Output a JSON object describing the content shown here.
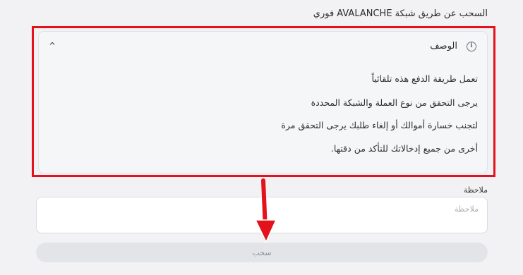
{
  "page": {
    "title": "السحب عن طريق شبكة AVALANCHE فوري"
  },
  "description": {
    "title": "الوصف",
    "info_icon": "i",
    "chevron_icon": "^",
    "lines": [
      "تعمل طريقة الدفع هذه تلقائياً",
      "يرجى التحقق من نوع العملة والشبكة المحددة",
      "لتجنب خسارة أموالك أو إلغاء طلبك يرجى التحقق مرة",
      "أخرى من جميع إدخالاتك للتأكد من دقتها."
    ]
  },
  "note": {
    "label": "ملاحظة",
    "placeholder": "ملاحظة",
    "value": ""
  },
  "submit": {
    "label": "سحب"
  },
  "annotation": {
    "color": "#e3121b"
  }
}
